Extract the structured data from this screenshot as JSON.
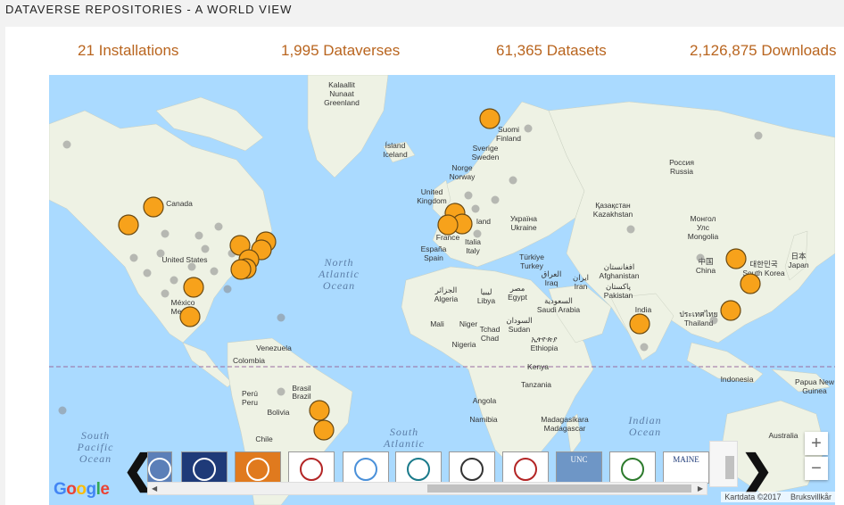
{
  "page": {
    "title": "DATAVERSE REPOSITORIES - A WORLD VIEW"
  },
  "stats": {
    "installations": "21 Installations",
    "dataverses": "1,995 Dataverses",
    "datasets": "61,365 Datasets",
    "downloads": "2,126,875 Downloads"
  },
  "map": {
    "oceans": {
      "north_atlantic": [
        "North",
        "Atlantic",
        "Ocean"
      ],
      "south_atlantic": [
        "South",
        "Atlantic"
      ],
      "south_pacific": [
        "South",
        "Pacific",
        "Ocean"
      ],
      "indian": [
        "Indian",
        "Ocean"
      ]
    },
    "labels": {
      "greenland": [
        "Kalaallit",
        "Nunaat",
        "Greenland"
      ],
      "iceland": [
        "Ísland",
        "Iceland"
      ],
      "canada": "Canada",
      "united_states": "United States",
      "mexico": [
        "México",
        "Mexico"
      ],
      "venezuela": "Venezuela",
      "colombia": "Colombia",
      "brazil": [
        "Brasil",
        "Brazil"
      ],
      "peru": [
        "Perú",
        "Peru"
      ],
      "bolivia": "Bolivia",
      "chile": "Chile",
      "finland": [
        "Suomi",
        "Finland"
      ],
      "sweden": [
        "Sverige",
        "Sweden"
      ],
      "norway": [
        "Norge",
        "Norway"
      ],
      "uk": [
        "United",
        "Kingdom"
      ],
      "poland": "land",
      "ukraine": [
        "Україна",
        "Ukraine"
      ],
      "france": "France",
      "spain": [
        "España",
        "Spain"
      ],
      "italy": [
        "Italia",
        "Italy"
      ],
      "turkey": [
        "Türkiye",
        "Turkey"
      ],
      "algeria": [
        "الجزائر",
        "Algeria"
      ],
      "libya": [
        "ليبيا",
        "Libya"
      ],
      "egypt": [
        "مصر",
        "Egypt"
      ],
      "iraq": [
        "العراق",
        "Iraq"
      ],
      "iran": [
        "ایران",
        "Iran"
      ],
      "saudi": [
        "السعودية",
        "Saudi Arabia"
      ],
      "mali": "Mali",
      "niger": "Niger",
      "chad": [
        "Tchad",
        "Chad"
      ],
      "sudan": [
        "السودان",
        "Sudan"
      ],
      "nigeria": "Nigeria",
      "ethiopia": [
        "ኢትዮጵያ",
        "Ethiopia"
      ],
      "kenya": "Kenya",
      "tanzania": "Tanzania",
      "angola": "Angola",
      "namibia": "Namibia",
      "madagascar": [
        "Madagasikara",
        "Madagascar"
      ],
      "kazakhstan": [
        "Қазақстан",
        "Kazakhstan"
      ],
      "russia": [
        "Россия",
        "Russia"
      ],
      "mongolia": [
        "Монгол",
        "Улс",
        "Mongolia"
      ],
      "afghanistan": [
        "افغانستان",
        "Afghanistan"
      ],
      "pakistan": [
        "پاکستان",
        "Pakistan"
      ],
      "india": "India",
      "china": [
        "中国",
        "China"
      ],
      "south_korea": [
        "대한민국",
        "South Korea"
      ],
      "japan": [
        "日本",
        "Japan"
      ],
      "thailand": [
        "ประเทศไทย",
        "Thailand"
      ],
      "indonesia": "Indonesia",
      "png": [
        "Papua New",
        "Guinea"
      ],
      "australia": "Australia"
    },
    "zoom_in_label": "+",
    "zoom_out_label": "−",
    "attribution": "Kartdata ©2017",
    "terms": "Bruksvillkår",
    "google_letters": [
      "G",
      "o",
      "o",
      "g",
      "l",
      "e"
    ],
    "colors": {
      "marker_fill": "#f7a21b",
      "marker_stroke": "#6b4a12",
      "ocean": "#aadaff",
      "land": "#eef2e4"
    }
  },
  "carousel": {
    "prev_label": "❮",
    "next_label": "❯",
    "logos": [
      {
        "name": "dataverse-logo-1"
      },
      {
        "name": "johns-hopkins-logo"
      },
      {
        "name": "orange-building-logo"
      },
      {
        "name": "red-seal-logo"
      },
      {
        "name": "blue-circles-logo"
      },
      {
        "name": "blue-star-logo"
      },
      {
        "name": "university-seal-logo"
      },
      {
        "name": "red-compass-logo"
      },
      {
        "name": "unc-logo",
        "text": "UNC"
      },
      {
        "name": "green-shield-logo"
      },
      {
        "name": "maine-logo",
        "text": "MAINE"
      }
    ]
  }
}
